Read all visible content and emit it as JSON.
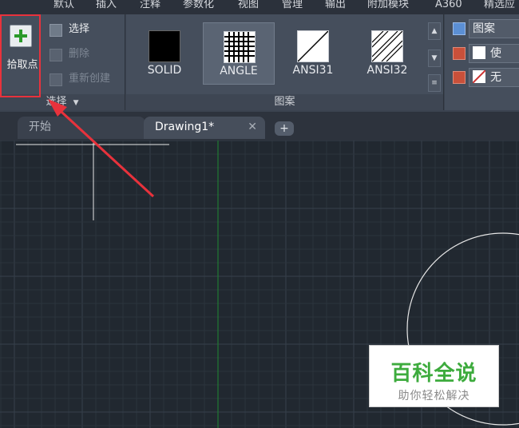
{
  "menubar": {
    "items": [
      "默认",
      "插入",
      "注释",
      "参数化",
      "视图",
      "管理",
      "输出",
      "附加模块",
      "A360",
      "精选应"
    ]
  },
  "ribbon": {
    "select_panel": {
      "pick_points_label": "拾取点",
      "select_label": "选择",
      "delete_label": "删除",
      "recreate_label": "重新创建",
      "title": "选择"
    },
    "pattern_panel": {
      "patterns": [
        {
          "label": "SOLID"
        },
        {
          "label": "ANGLE",
          "selected": true
        },
        {
          "label": "ANSI31"
        },
        {
          "label": "ANSI32"
        }
      ],
      "title": "图案"
    },
    "properties_panel": {
      "type_value": "图案",
      "color_value": "使",
      "background_value": "无"
    }
  },
  "tabs": {
    "start_label": "开始",
    "drawing_label": "Drawing1*",
    "close_glyph": "✕",
    "add_glyph": "+"
  },
  "watermark": {
    "title": "百科全说",
    "subtitle": "助你轻松解决"
  },
  "colors": {
    "highlight": "#e8323c",
    "canvas_bg": "#212830",
    "grid_minor": "#2c343d",
    "grid_major": "#36404b",
    "y_axis": "#1f7a32",
    "watermark_green": "#3dab3d"
  }
}
